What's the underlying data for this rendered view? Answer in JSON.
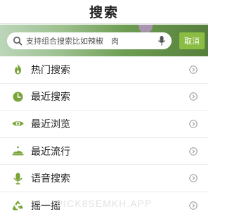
{
  "header": {
    "title": "搜索"
  },
  "search": {
    "placeholder": "支持组合搜索比如辣椒　肉",
    "cancel_label": "取消"
  },
  "menu": [
    {
      "label": "热门搜索",
      "icon": "fire-icon"
    },
    {
      "label": "最近搜索",
      "icon": "clock-icon"
    },
    {
      "label": "最近浏览",
      "icon": "eye-icon"
    },
    {
      "label": "最近流行",
      "icon": "food-cover-icon"
    },
    {
      "label": "语音搜索",
      "icon": "microphone-icon"
    },
    {
      "label": "摇一摇",
      "icon": "recycle-icon"
    }
  ],
  "watermark": "PICK8SEMKH.APP",
  "colors": {
    "accent": "#8bbd45",
    "icon": "#7aa43a"
  }
}
